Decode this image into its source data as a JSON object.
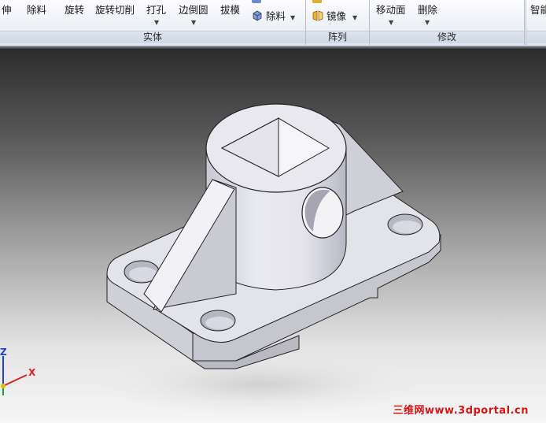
{
  "ribbon": {
    "solid_group": {
      "caption": "实体",
      "buttons": {
        "extrude": "伸",
        "remove": "除料",
        "revolve": "旋转",
        "revolve_cut": "旋转切削",
        "hole": "打孔",
        "fillet": "边倒圆",
        "draft": "拔模",
        "small_remove": "除料"
      }
    },
    "array_group": {
      "caption": "阵列",
      "buttons": {
        "mirror": "镜像"
      }
    },
    "modify_group": {
      "caption": "修改",
      "buttons": {
        "move_face": "移动面",
        "delete": "删除"
      }
    },
    "smart_group": {
      "button": "智能"
    }
  },
  "viewport": {
    "axis": {
      "z": "Z",
      "x": "X"
    },
    "watermark": "三维网www.3dportal.cn"
  },
  "colors": {
    "part_face": "#d6d6dc",
    "part_top": "#e8e8ee",
    "axis_x": "#e02020",
    "axis_z": "#2040e0",
    "watermark": "#e01010"
  }
}
